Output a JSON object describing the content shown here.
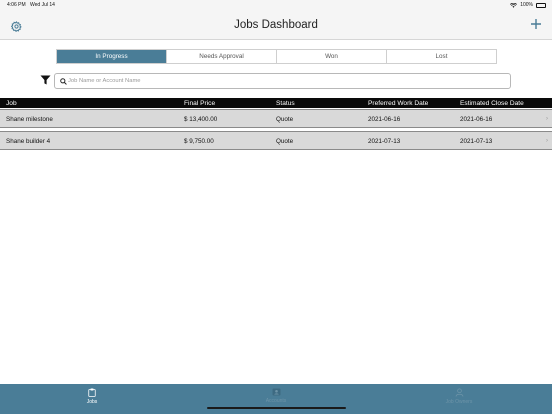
{
  "status_bar": {
    "time": "4:06 PM",
    "date": "Wed Jul 14",
    "battery": "100%"
  },
  "header": {
    "title": "Jobs Dashboard",
    "settings_icon": "gear-icon",
    "add_icon": "plus-icon",
    "accent_color": "#4a7d97"
  },
  "segments": [
    {
      "label": "In Progress",
      "active": true
    },
    {
      "label": "Needs Approval",
      "active": false
    },
    {
      "label": "Won",
      "active": false
    },
    {
      "label": "Lost",
      "active": false
    }
  ],
  "search": {
    "placeholder": "Job Name or Account Name",
    "value": ""
  },
  "table": {
    "columns": [
      "Job",
      "Final Price",
      "Status",
      "Preferred Work Date",
      "Estimated Close Date"
    ],
    "rows": [
      [
        "Shane milestone",
        "$ 13,400.00",
        "Quote",
        "2021-06-16",
        "2021-06-16"
      ],
      [
        "Shane builder 4",
        "$ 9,750.00",
        "Quote",
        "2021-07-13",
        "2021-07-13"
      ]
    ]
  },
  "tabbar": {
    "tabs": [
      {
        "label": "Jobs",
        "icon": "clipboard-icon",
        "active": true
      },
      {
        "label": "Accounts",
        "icon": "contact-card-icon",
        "active": false
      },
      {
        "label": "Job Owners",
        "icon": "person-icon",
        "active": false
      }
    ]
  }
}
